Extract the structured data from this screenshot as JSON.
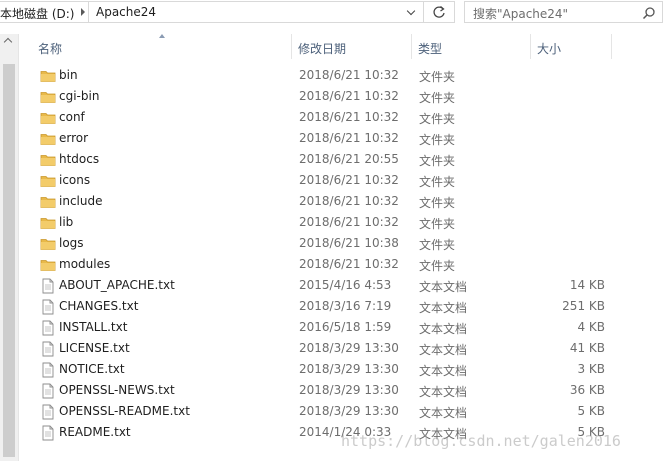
{
  "address": {
    "drive": "本地磁盘 (D:)",
    "folder": "Apache24"
  },
  "search": {
    "placeholder": "搜索\"Apache24\""
  },
  "columns": {
    "name": "名称",
    "date": "修改日期",
    "type": "类型",
    "size": "大小"
  },
  "files": [
    {
      "name": "bin",
      "date": "2018/6/21 10:32",
      "type": "文件夹",
      "size": "",
      "kind": "folder"
    },
    {
      "name": "cgi-bin",
      "date": "2018/6/21 10:32",
      "type": "文件夹",
      "size": "",
      "kind": "folder"
    },
    {
      "name": "conf",
      "date": "2018/6/21 10:32",
      "type": "文件夹",
      "size": "",
      "kind": "folder"
    },
    {
      "name": "error",
      "date": "2018/6/21 10:32",
      "type": "文件夹",
      "size": "",
      "kind": "folder"
    },
    {
      "name": "htdocs",
      "date": "2018/6/21 20:55",
      "type": "文件夹",
      "size": "",
      "kind": "folder"
    },
    {
      "name": "icons",
      "date": "2018/6/21 10:32",
      "type": "文件夹",
      "size": "",
      "kind": "folder"
    },
    {
      "name": "include",
      "date": "2018/6/21 10:32",
      "type": "文件夹",
      "size": "",
      "kind": "folder"
    },
    {
      "name": "lib",
      "date": "2018/6/21 10:32",
      "type": "文件夹",
      "size": "",
      "kind": "folder"
    },
    {
      "name": "logs",
      "date": "2018/6/21 10:38",
      "type": "文件夹",
      "size": "",
      "kind": "folder"
    },
    {
      "name": "modules",
      "date": "2018/6/21 10:32",
      "type": "文件夹",
      "size": "",
      "kind": "folder"
    },
    {
      "name": "ABOUT_APACHE.txt",
      "date": "2015/4/16 4:53",
      "type": "文本文档",
      "size": "14 KB",
      "kind": "text"
    },
    {
      "name": "CHANGES.txt",
      "date": "2018/3/16 7:19",
      "type": "文本文档",
      "size": "251 KB",
      "kind": "text"
    },
    {
      "name": "INSTALL.txt",
      "date": "2016/5/18 1:59",
      "type": "文本文档",
      "size": "4 KB",
      "kind": "text"
    },
    {
      "name": "LICENSE.txt",
      "date": "2018/3/29 13:30",
      "type": "文本文档",
      "size": "41 KB",
      "kind": "text"
    },
    {
      "name": "NOTICE.txt",
      "date": "2018/3/29 13:30",
      "type": "文本文档",
      "size": "3 KB",
      "kind": "text"
    },
    {
      "name": "OPENSSL-NEWS.txt",
      "date": "2018/3/29 13:30",
      "type": "文本文档",
      "size": "36 KB",
      "kind": "text"
    },
    {
      "name": "OPENSSL-README.txt",
      "date": "2018/3/29 13:30",
      "type": "文本文档",
      "size": "5 KB",
      "kind": "text"
    },
    {
      "name": "README.txt",
      "date": "2014/1/24 0:33",
      "type": "文本文档",
      "size": "5 KB",
      "kind": "text"
    }
  ],
  "watermark": "https://blog.csdn.net/galen2016",
  "colors": {
    "folder": "#e8b94a",
    "header_text": "#4c607a",
    "muted_text": "#6d6d6d"
  }
}
